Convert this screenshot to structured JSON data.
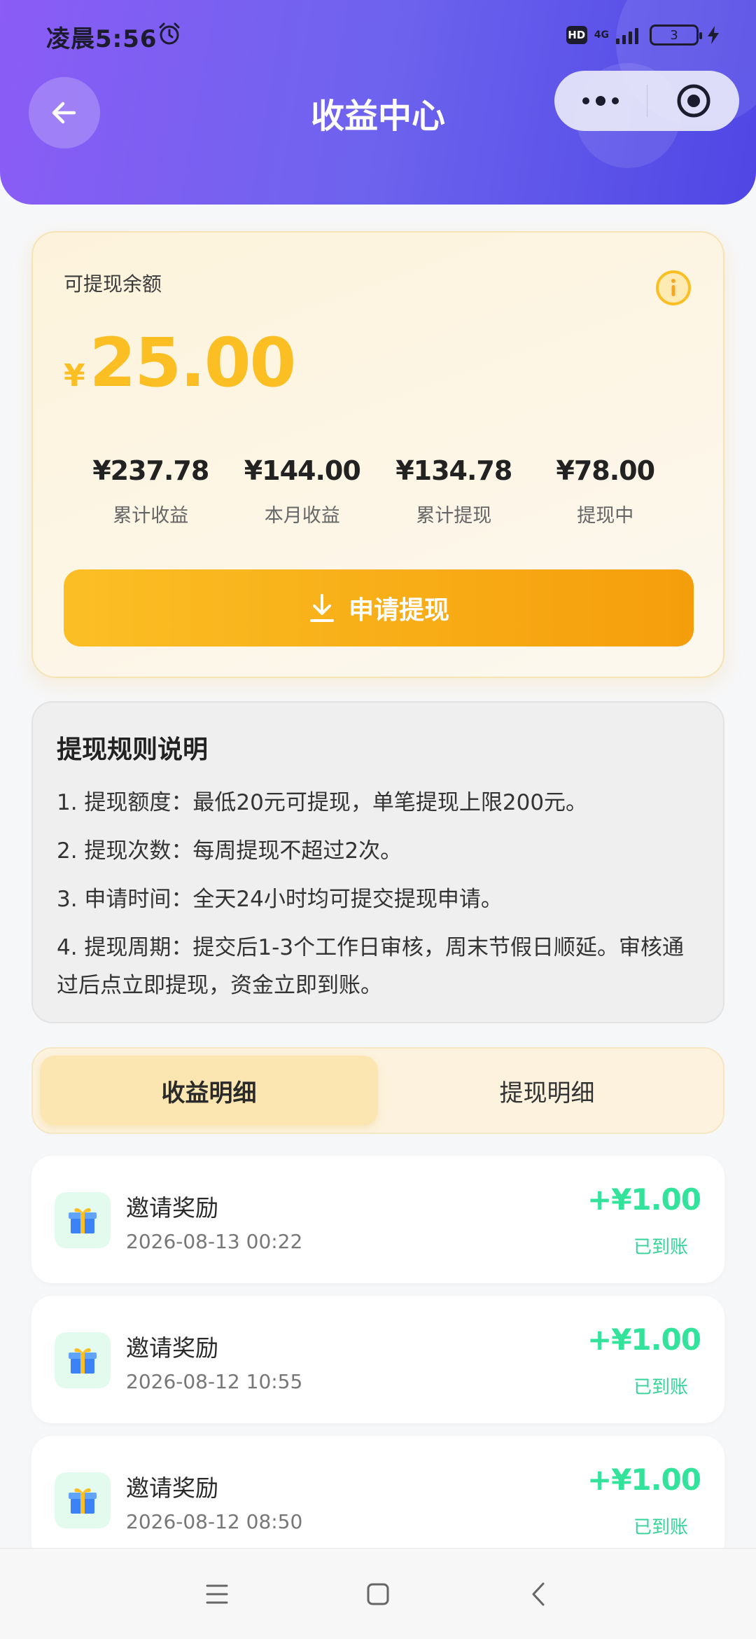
{
  "status_bar": {
    "time": "凌晨5:56",
    "hd": "HD",
    "network": "4G",
    "battery": "3"
  },
  "header": {
    "title": "收益中心"
  },
  "balance": {
    "label": "可提现余额",
    "currency": "¥",
    "amount": "25.00",
    "stats": [
      {
        "value": "¥237.78",
        "label": "累计收益"
      },
      {
        "value": "¥144.00",
        "label": "本月收益"
      },
      {
        "value": "¥134.78",
        "label": "累计提现"
      },
      {
        "value": "¥78.00",
        "label": "提现中"
      }
    ],
    "withdraw_button": "申请提现"
  },
  "rules": {
    "title": "提现规则说明",
    "items": [
      "1. 提现额度：最低20元可提现，单笔提现上限200元。",
      "2. 提现次数：每周提现不超过2次。",
      "3. 申请时间：全天24小时均可提交提现申请。",
      "4. 提现周期：提交后1-3个工作日审核，周末节假日顺延。审核通过后点立即提现，资金立即到账。"
    ]
  },
  "tabs": [
    {
      "label": "收益明细",
      "active": true
    },
    {
      "label": "提现明细",
      "active": false
    }
  ],
  "records": [
    {
      "title": "邀请奖励",
      "date": "2026-08-13 00:22",
      "amount": "+¥1.00",
      "status": "已到账"
    },
    {
      "title": "邀请奖励",
      "date": "2026-08-12 10:55",
      "amount": "+¥1.00",
      "status": "已到账"
    },
    {
      "title": "邀请奖励",
      "date": "2026-08-12 08:50",
      "amount": "+¥1.00",
      "status": "已到账"
    }
  ],
  "colors": {
    "header_gradient_start": "#8b5cf6",
    "header_gradient_end": "#4f46e5",
    "accent_gold": "#fbbf24",
    "button_orange": "#f59e0b",
    "income_green": "#34e39b"
  },
  "icons": {
    "back": "arrow-left-icon",
    "more": "more-dots-icon",
    "target": "target-icon",
    "info": "info-icon",
    "download": "download-icon",
    "gift": "gift-icon",
    "nav_menu": "menu-icon",
    "nav_home": "home-square-icon",
    "nav_back": "chevron-left-icon"
  }
}
